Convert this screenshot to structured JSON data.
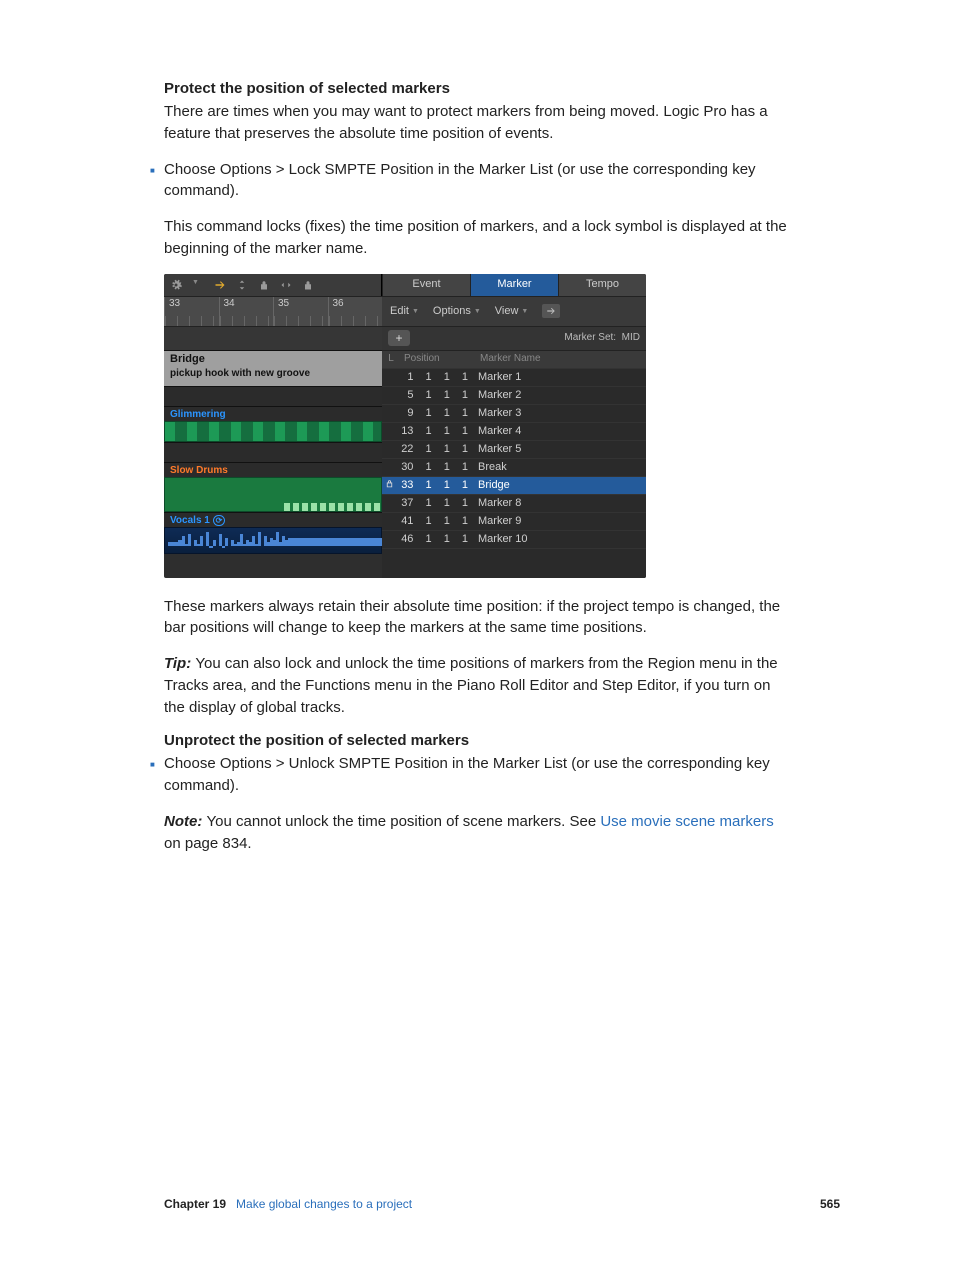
{
  "headings": {
    "protect": "Protect the position of selected markers",
    "unprotect": "Unprotect the position of selected markers"
  },
  "paragraphs": {
    "p1": "There are times when you may want to protect markers from being moved. Logic Pro has a feature that preserves the absolute time position of events.",
    "li1": "Choose Options > Lock SMPTE Position in the Marker List (or use the corresponding key command).",
    "p2": "This command locks (fixes) the time position of markers, and a lock symbol is displayed at the beginning of the marker name.",
    "p3": "These markers always retain their absolute time position: if the project tempo is changed, the bar positions will change to keep the markers at the same time positions.",
    "tip_label": "Tip:  ",
    "tip": "You can also lock and unlock the time positions of markers from the Region menu in the Tracks area, and the Functions menu in the Piano Roll Editor and Step Editor, if you turn on the display of global tracks.",
    "li2": "Choose Options > Unlock SMPTE Position in the Marker List (or use the corresponding key command).",
    "note_label": "Note:  ",
    "note_a": "You cannot unlock the time position of scene markers. See ",
    "note_link": "Use movie scene markers",
    "note_b": " on page 834."
  },
  "screenshot": {
    "ruler": [
      "33",
      "34",
      "35",
      "36"
    ],
    "tabs": {
      "event": "Event",
      "marker": "Marker",
      "tempo": "Tempo"
    },
    "menus": {
      "edit": "Edit",
      "options": "Options",
      "view": "View"
    },
    "marker_set_label": "Marker Set:",
    "marker_set_value": "MID",
    "headers": {
      "l": "L",
      "position": "Position",
      "name": "Marker Name"
    },
    "markers": [
      {
        "pos": [
          "1",
          "1",
          "1",
          "1"
        ],
        "name": "Marker 1",
        "locked": false,
        "selected": false
      },
      {
        "pos": [
          "5",
          "1",
          "1",
          "1"
        ],
        "name": "Marker 2",
        "locked": false,
        "selected": false
      },
      {
        "pos": [
          "9",
          "1",
          "1",
          "1"
        ],
        "name": "Marker 3",
        "locked": false,
        "selected": false
      },
      {
        "pos": [
          "13",
          "1",
          "1",
          "1"
        ],
        "name": "Marker 4",
        "locked": false,
        "selected": false
      },
      {
        "pos": [
          "22",
          "1",
          "1",
          "1"
        ],
        "name": "Marker 5",
        "locked": false,
        "selected": false
      },
      {
        "pos": [
          "30",
          "1",
          "1",
          "1"
        ],
        "name": "Break",
        "locked": false,
        "selected": false
      },
      {
        "pos": [
          "33",
          "1",
          "1",
          "1"
        ],
        "name": "Bridge",
        "locked": true,
        "selected": true
      },
      {
        "pos": [
          "37",
          "1",
          "1",
          "1"
        ],
        "name": "Marker 8",
        "locked": false,
        "selected": false
      },
      {
        "pos": [
          "41",
          "1",
          "1",
          "1"
        ],
        "name": "Marker 9",
        "locked": false,
        "selected": false
      },
      {
        "pos": [
          "46",
          "1",
          "1",
          "1"
        ],
        "name": "Marker 10",
        "locked": false,
        "selected": false
      }
    ],
    "lanes": {
      "bridge_title": "Bridge",
      "bridge_sub": "pickup hook with new groove",
      "glimmering": "Glimmering",
      "slow": "Slow Drums",
      "vocals": "Vocals 1"
    }
  },
  "footer": {
    "chapter_label": "Chapter  19",
    "chapter_title": "Make global changes to a project",
    "page": "565"
  }
}
